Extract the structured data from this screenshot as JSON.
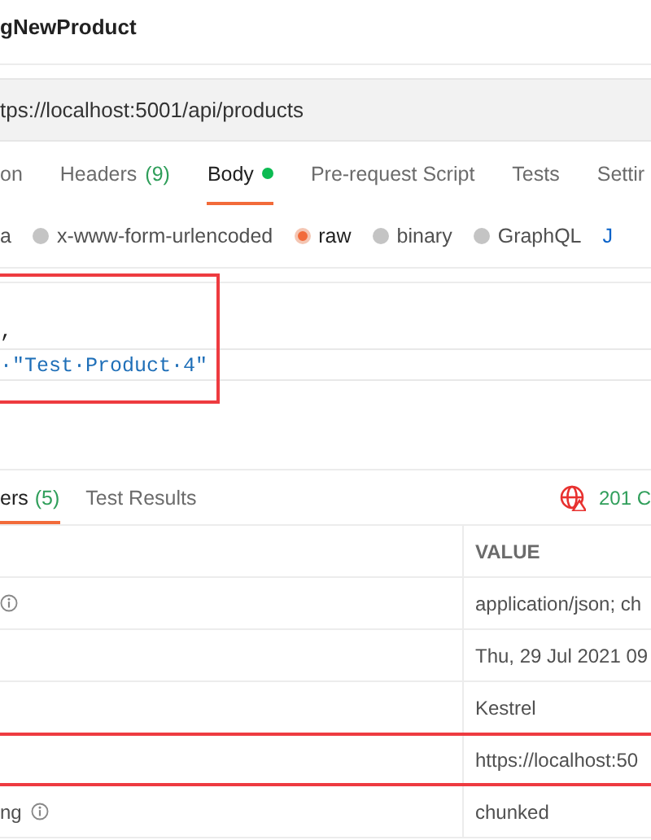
{
  "request": {
    "title": "gNewProduct",
    "url": "tps://localhost:5001/api/products"
  },
  "request_tabs": [
    {
      "label": "on",
      "selected": false,
      "dot": false
    },
    {
      "label": "Headers",
      "count": "(9)",
      "selected": false,
      "dot": false
    },
    {
      "label": "Body",
      "selected": true,
      "dot": true
    },
    {
      "label": "Pre-request Script",
      "selected": false,
      "dot": false
    },
    {
      "label": "Tests",
      "selected": false,
      "dot": false
    },
    {
      "label": "Settir",
      "selected": false,
      "dot": false
    }
  ],
  "body_types": [
    {
      "kind": "plain",
      "label": "a"
    },
    {
      "kind": "radio",
      "label": "x-www-form-urlencoded",
      "selected": false
    },
    {
      "kind": "radio",
      "label": "raw",
      "selected": true
    },
    {
      "kind": "radio",
      "label": "binary",
      "selected": false
    },
    {
      "kind": "radio",
      "label": "GraphQL",
      "selected": false
    },
    {
      "kind": "link",
      "label": "J"
    }
  ],
  "editor": {
    "annotated": true,
    "lines": [
      {
        "text": ",",
        "highlighted": false
      },
      {
        "text": "·\"Test·Product·4\"",
        "highlighted": true
      }
    ]
  },
  "response": {
    "tabs": [
      {
        "label": "ers",
        "count": "(5)",
        "selected": true
      },
      {
        "label": "Test Results",
        "selected": false
      }
    ],
    "status": "201 C",
    "headers": {
      "columns": [
        "VALUE"
      ],
      "rows": [
        {
          "info": true,
          "value": "application/json; ch",
          "annotated": false
        },
        {
          "info": false,
          "value": "Thu, 29 Jul 2021 09",
          "annotated": false
        },
        {
          "info": false,
          "value": "Kestrel",
          "annotated": false
        },
        {
          "info": false,
          "value": "https://localhost:50",
          "annotated": true
        },
        {
          "key": "ng",
          "info": true,
          "value": "chunked",
          "annotated": false
        }
      ]
    }
  }
}
